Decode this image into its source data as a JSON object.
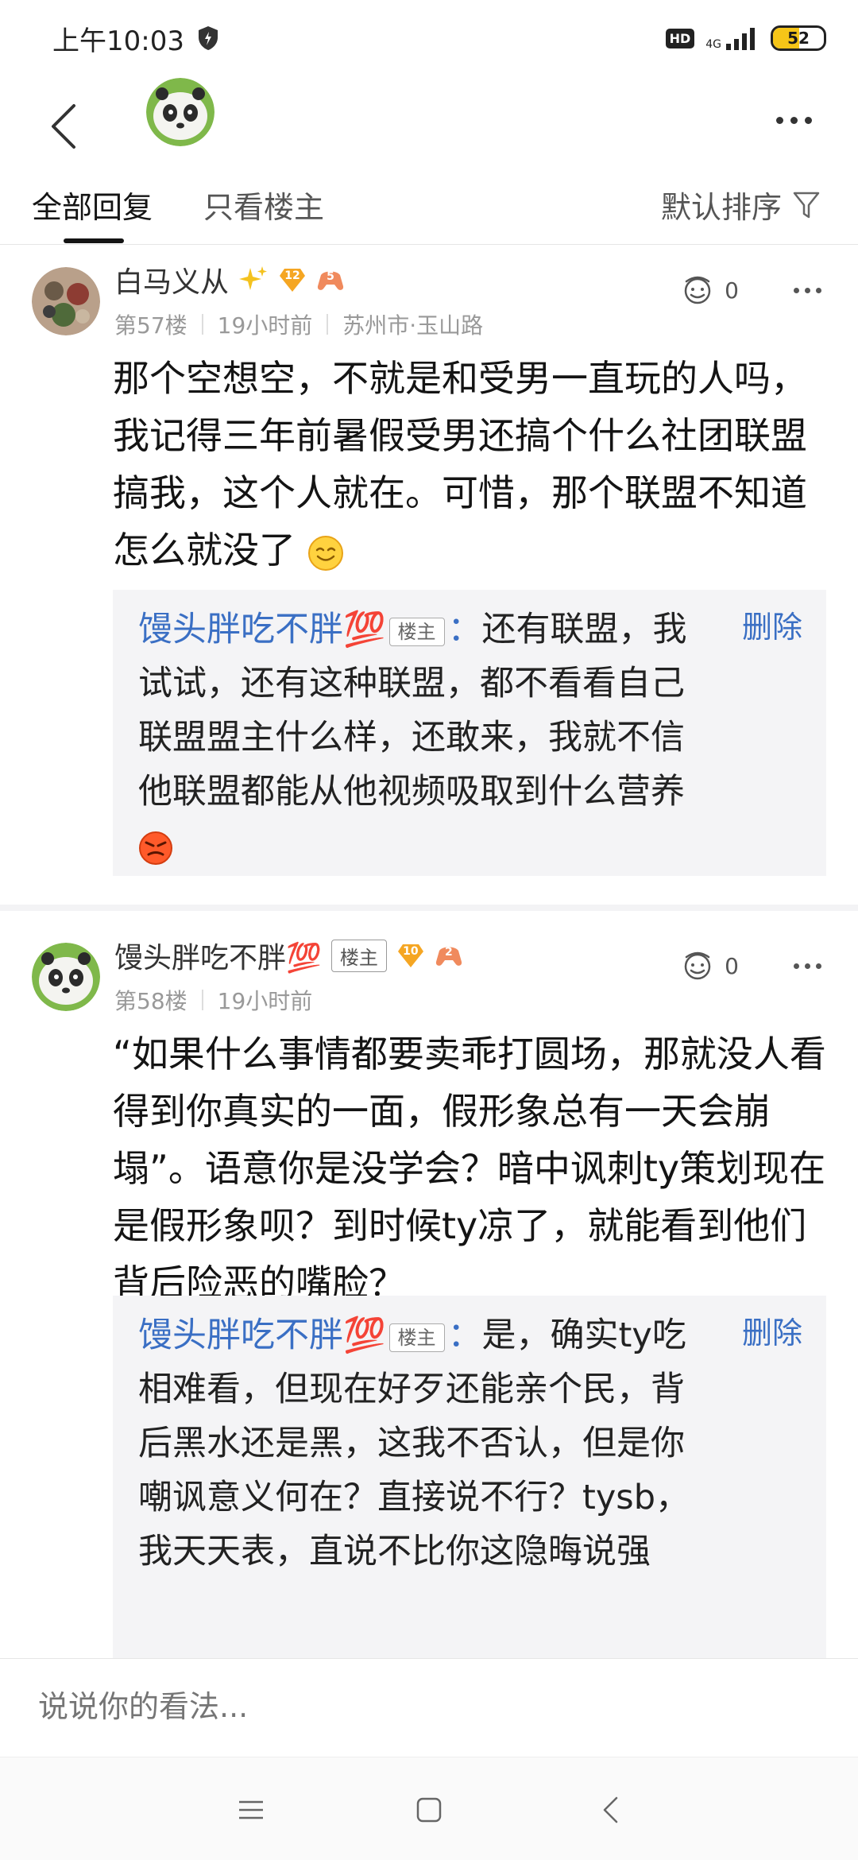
{
  "status_bar": {
    "time": "上午10:03",
    "hd": "HD",
    "network": "4G",
    "battery": "52",
    "battery_level": 0.52
  },
  "tabs": {
    "all": "全部回复",
    "op_only": "只看楼主",
    "sort": "默认排序"
  },
  "posts": [
    {
      "username": "白马义从",
      "level": "12",
      "game_level": "5",
      "floor": "第57楼",
      "time": "19小时前",
      "location": "苏州市·玉山路",
      "likes": "0",
      "content": "那个空想空，不就是和受男一直玩的人吗，我记得三年前暑假受男还搞个什么社团联盟搞我，这个人就在。可惜，那个联盟不知道怎么就没了",
      "reply": {
        "author": "馒头胖吃不胖💯",
        "op_tag": "楼主",
        "colon": "：",
        "text": "还有联盟，我试试，还有这种联盟，都不看看自己联盟盟主什么样，还敢来，我就不信他联盟都能从他视频吸取到什么营养",
        "delete": "删除"
      }
    },
    {
      "username": "馒头胖吃不胖💯",
      "op_tag": "楼主",
      "level": "10",
      "game_level": "2",
      "floor": "第58楼",
      "time": "19小时前",
      "likes": "0",
      "content": "“如果什么事情都要卖乖打圆场，那就没人看得到你真实的一面，假形象总有一天会崩塌”。语意你是没学会？暗中讽刺ty策划现在是假形象呗？到时候ty凉了，就能看到他们背后险恶的嘴脸？",
      "reply": {
        "author": "馒头胖吃不胖💯",
        "op_tag": "楼主",
        "colon": "：",
        "text": "是，确实ty吃相难看，但现在好歹还能亲个民，背后黑水还是黑，这我不否认，但是你嘲讽意义何在？直接说不行？tysb，我天天表，直说不比你这隐晦说强",
        "delete": "删除"
      }
    }
  ],
  "input": {
    "placeholder": "说说你的看法..."
  },
  "colors": {
    "link_blue": "#3a6fc4",
    "battery_yellow": "#f5c518"
  }
}
